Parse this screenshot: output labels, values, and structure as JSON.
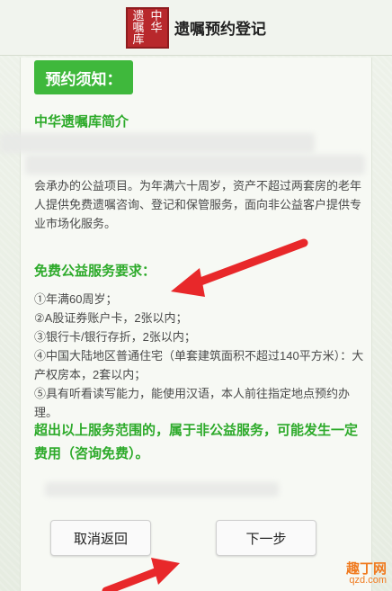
{
  "header": {
    "logo_chars": [
      "遗",
      "中",
      "嘱",
      "华",
      "库",
      ""
    ],
    "title": "遗嘱预约登记"
  },
  "notice_button": {
    "label": "预约须知："
  },
  "intro": {
    "title": "中华遗嘱库简介",
    "text": "会承办的公益项目。为年满六十周岁，资产不超过两套房的老年人提供免费遗嘱咨询、登记和保管服务，面向非公益客户提供专业市场化服务。"
  },
  "requirements": {
    "title": "免费公益服务要求：",
    "items": [
      "①年满60周岁；",
      "②A股证券账户卡，2张以内；",
      "③银行卡/银行存折，2张以内；",
      "④中国大陆地区普通住宅（单套建筑面积不超过140平方米）：大产权房本，2套以内；",
      "⑤具有听看读写能力，能使用汉语，本人前往指定地点预约办理。"
    ]
  },
  "warning": "超出以上服务范围的，属于非公益服务，可能发生一定费用（咨询免费）。",
  "buttons": {
    "cancel": "取消返回",
    "next": "下一步"
  },
  "watermark": {
    "line1": "趣丁网",
    "line2": "qzd.com"
  },
  "colors": {
    "accent_green": "#3fb83c",
    "title_green": "#2daa2a",
    "arrow_red": "#e8282a"
  }
}
